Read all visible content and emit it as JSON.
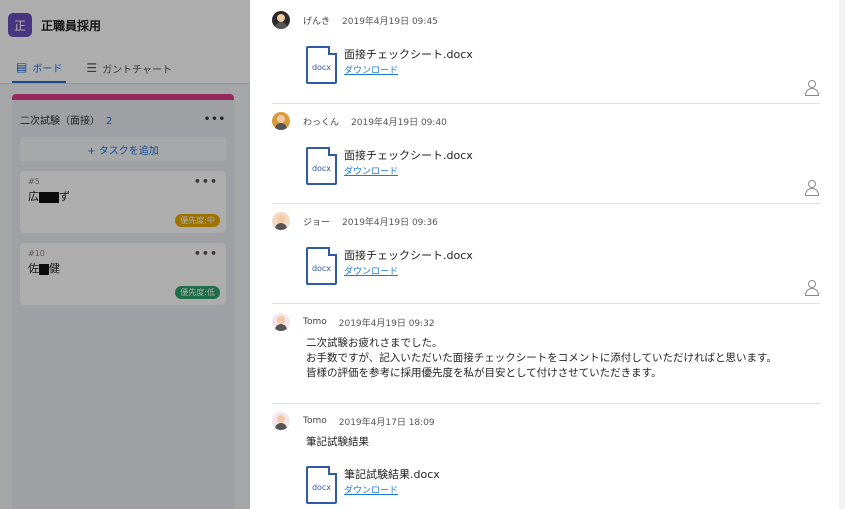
{
  "project": {
    "badge": "正",
    "name": "正職員採用"
  },
  "view_tabs": [
    {
      "icon": "▤",
      "label": "ボード",
      "active": true
    },
    {
      "icon": "☰",
      "label": "ガントチャート",
      "active": false
    }
  ],
  "column": {
    "title": "二次試験（面接）",
    "count": "2",
    "more": "•••",
    "add_task": "+ タスクを追加",
    "cards": [
      {
        "num": "#5",
        "name_a": "広",
        "name_b": "ず",
        "more": "•••",
        "priority": "優先度:中"
      },
      {
        "num": "#10",
        "name_a": "佐",
        "name_b": "健",
        "more": "•••",
        "priority": "優先度:低"
      }
    ]
  },
  "comments": [
    {
      "user": "げんき",
      "time": "2019年4月19日 09:45",
      "file": {
        "ext": "docx",
        "name": "面接チェックシート.docx",
        "download": "ダウンロード"
      }
    },
    {
      "user": "わっくん",
      "time": "2019年4月19日 09:40",
      "file": {
        "ext": "docx",
        "name": "面接チェックシート.docx",
        "download": "ダウンロード"
      }
    },
    {
      "user": "ジョー",
      "time": "2019年4月19日 09:36",
      "file": {
        "ext": "docx",
        "name": "面接チェックシート.docx",
        "download": "ダウンロード"
      }
    },
    {
      "user": "Tomo",
      "time": "2019年4月19日 09:32",
      "lines": [
        "二次試験お疲れさまでした。",
        "お手数ですが、記入いただいた面接チェックシートをコメントに添付していただければと思います。",
        "皆様の評価を参考に採用優先度を私が目安として付けさせていただきます。"
      ]
    },
    {
      "user": "Tomo",
      "time": "2019年4月17日 18:09",
      "text": "筆記試験結果",
      "file": {
        "ext": "docx",
        "name": "筆記試験結果.docx",
        "download": "ダウンロード"
      }
    }
  ]
}
